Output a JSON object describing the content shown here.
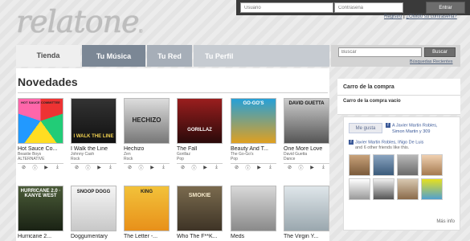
{
  "logo": {
    "text": "relatone",
    "reg": "®"
  },
  "login": {
    "user_placeholder": "Usuario",
    "pass_placeholder": "Contraseña",
    "enter_label": "Entrar",
    "register_label": "Registro",
    "separator": " | ",
    "forgot_label": "¿Olvidó su contraseña?"
  },
  "tabs": [
    "Tienda",
    "Tu Música",
    "Tu Red",
    "Tu Perfil"
  ],
  "search": {
    "placeholder": "Buscar",
    "button": "Buscar",
    "advanced": "Búsquedas Recientes"
  },
  "main": {
    "title": "Novedades",
    "albums": [
      {
        "title": "Hot Sauce Co...",
        "artist": "Beastie Boys",
        "genre": "ALTERNATIVE",
        "cover_text": "HOT SAUCE COMMITTEE"
      },
      {
        "title": "I Walk the Line",
        "artist": "Johnny Cash",
        "genre": "Rock",
        "cover_text": "I WALK THE LINE"
      },
      {
        "title": "Hechizo",
        "artist": "Zen",
        "genre": "Rock",
        "cover_text": "HECHIZO"
      },
      {
        "title": "The Fall",
        "artist": "Gorillaz",
        "genre": "Pop",
        "cover_text": "GORILLAZ"
      },
      {
        "title": "Beauty And T...",
        "artist": "The Go-Go's",
        "genre": "Pop",
        "cover_text": "GO-GO'S"
      },
      {
        "title": "One More Love",
        "artist": "David Guetta",
        "genre": "Dance",
        "cover_text": "DAVID GUETTA"
      },
      {
        "title": "Hurricane 2...",
        "artist": "",
        "genre": "",
        "cover_text": "HURRICANE 2.0 · KANYE WEST"
      },
      {
        "title": "Doggumentary",
        "artist": "",
        "genre": "",
        "cover_text": "SNOOP DOGG"
      },
      {
        "title": "The Letter -...",
        "artist": "",
        "genre": "",
        "cover_text": "KING"
      },
      {
        "title": "Who The F**K...",
        "artist": "",
        "genre": "",
        "cover_text": "SMOKIE"
      },
      {
        "title": "Meds",
        "artist": "",
        "genre": "",
        "cover_text": ""
      },
      {
        "title": "The Virgin Y...",
        "artist": "",
        "genre": "",
        "cover_text": ""
      }
    ],
    "controls": {
      "cancel": "⊘",
      "info": "ⓘ",
      "play": "▶",
      "download": "⤓"
    }
  },
  "sidebar": {
    "cart_title": "Carro de la compra",
    "cart_empty": "Carro de la compra vacío",
    "fb": {
      "like_label": "Me gusta",
      "line1": "A Javier Martin Robles,",
      "line1b": "Simon Martin y 309",
      "line2": "Javier Martin Robles, Iñigo De Luis",
      "line3": "and 6 other friends like this.",
      "more_info": "Más info"
    }
  },
  "colors": {
    "tab_active_bg": "#efefef",
    "tab_bg": "#808c99",
    "fb_blue": "#3b5998"
  }
}
